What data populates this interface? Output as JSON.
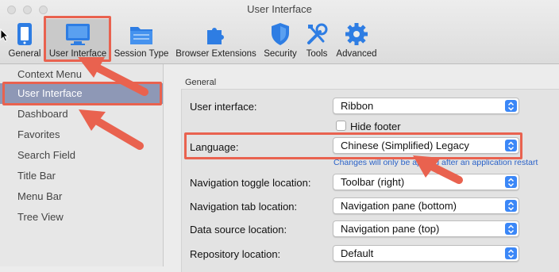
{
  "window": {
    "title": "User Interface"
  },
  "toolbar": {
    "items": [
      {
        "label": "General",
        "icon": "general-icon"
      },
      {
        "label": "User Interface",
        "icon": "user-interface-icon"
      },
      {
        "label": "Session Type",
        "icon": "session-type-icon"
      },
      {
        "label": "Browser Extensions",
        "icon": "browser-extensions-icon"
      },
      {
        "label": "Security",
        "icon": "security-icon"
      },
      {
        "label": "Tools",
        "icon": "tools-icon"
      },
      {
        "label": "Advanced",
        "icon": "advanced-icon"
      }
    ],
    "selected": "User Interface"
  },
  "sidebar": {
    "items": [
      {
        "label": "Context Menu"
      },
      {
        "label": "User Interface"
      },
      {
        "label": "Dashboard"
      },
      {
        "label": "Favorites"
      },
      {
        "label": "Search Field"
      },
      {
        "label": "Title Bar"
      },
      {
        "label": "Menu Bar"
      },
      {
        "label": "Tree View"
      }
    ],
    "selected": "User Interface"
  },
  "main": {
    "group_title": "General",
    "user_interface": {
      "label": "User interface:",
      "value": "Ribbon"
    },
    "hide_footer": {
      "label": "Hide footer",
      "checked": false
    },
    "language": {
      "label": "Language:",
      "value": "Chinese (Simplified) Legacy"
    },
    "restart_note": "Changes will only be applied after an application restart",
    "nav_toggle": {
      "label": "Navigation toggle location:",
      "value": "Toolbar (right)"
    },
    "nav_tab": {
      "label": "Navigation tab location:",
      "value": "Navigation pane (bottom)"
    },
    "data_source": {
      "label": "Data source location:",
      "value": "Navigation pane (top)"
    },
    "repository": {
      "label": "Repository location:",
      "value": "Default"
    }
  },
  "colors": {
    "highlight": "#e9624f",
    "accent_blue": "#3b87f7",
    "sidebar_selected": "#8e98b6",
    "note_blue": "#2a62c8"
  }
}
